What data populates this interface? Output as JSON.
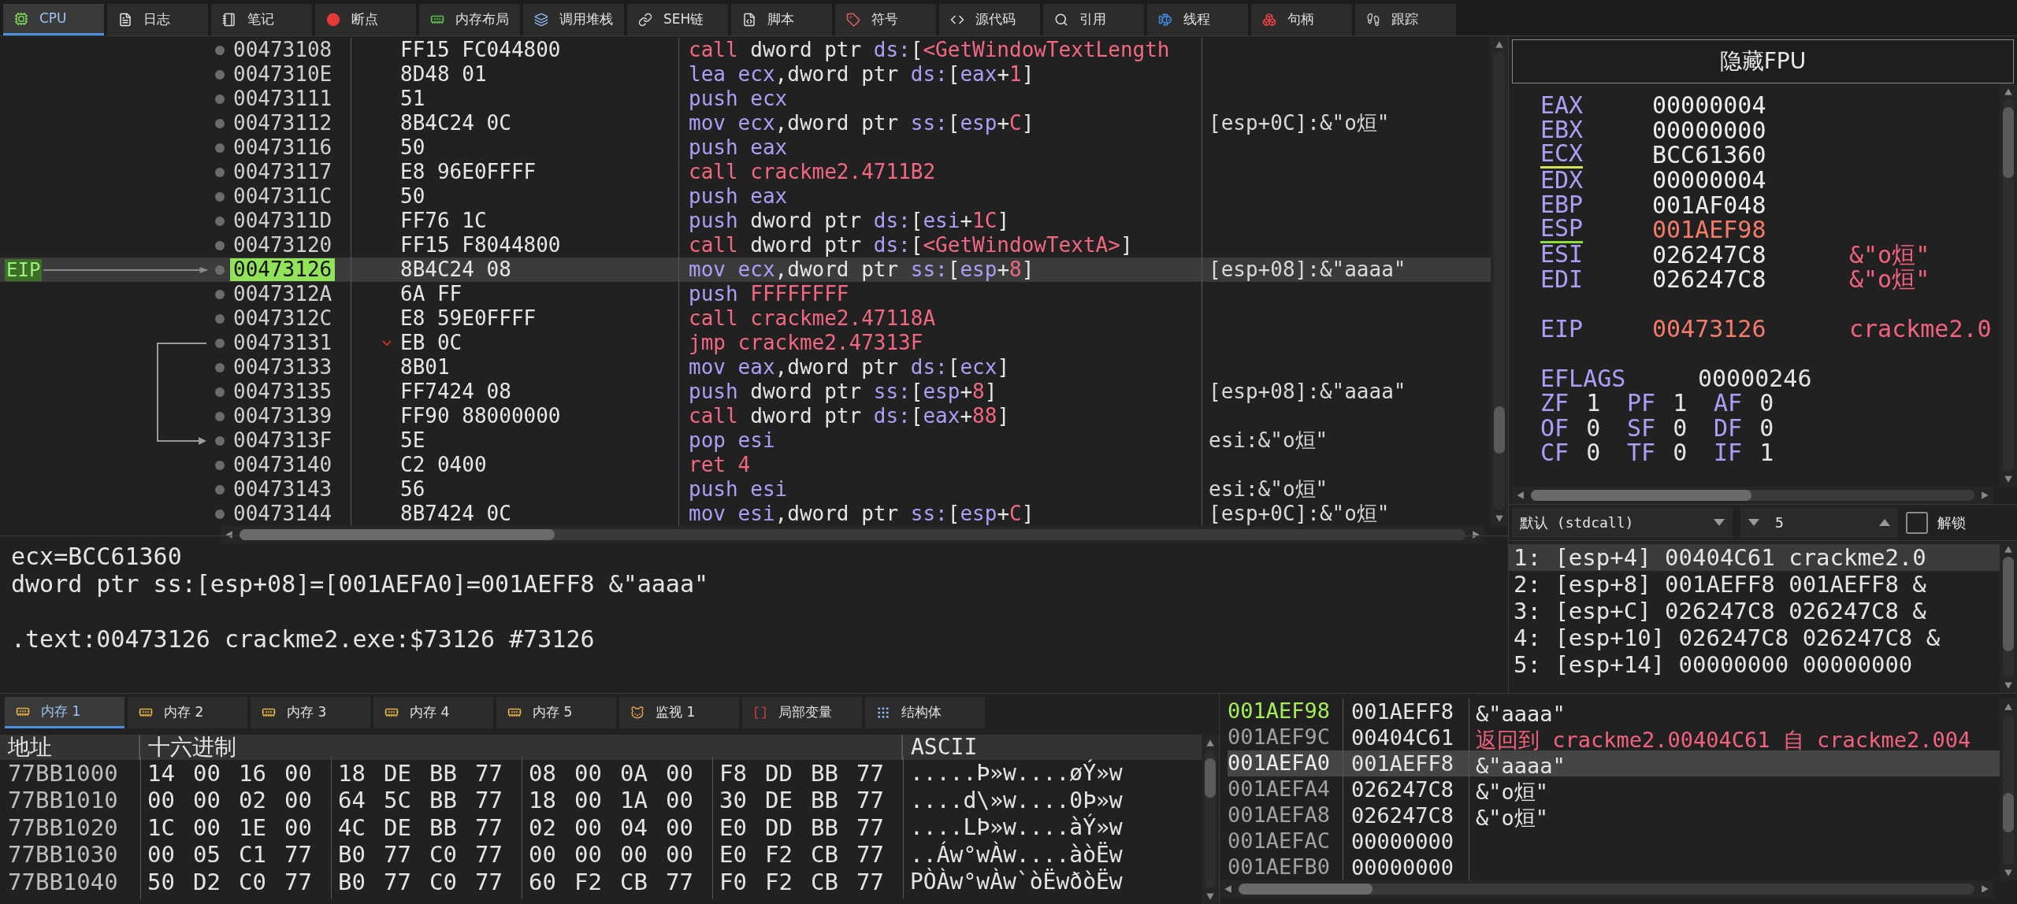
{
  "tabs": [
    {
      "label": "CPU",
      "selected": true
    },
    {
      "label": "日志",
      "selected": false
    },
    {
      "label": "笔记",
      "selected": false
    },
    {
      "label": "断点",
      "selected": false
    },
    {
      "label": "内存布局",
      "selected": false
    },
    {
      "label": "调用堆栈",
      "selected": false
    },
    {
      "label": "SEH链",
      "selected": false
    },
    {
      "label": "脚本",
      "selected": false
    },
    {
      "label": "符号",
      "selected": false
    },
    {
      "label": "源代码",
      "selected": false
    },
    {
      "label": "引用",
      "selected": false
    },
    {
      "label": "线程",
      "selected": false
    },
    {
      "label": "句柄",
      "selected": false
    },
    {
      "label": "跟踪",
      "selected": false
    }
  ],
  "disassembly": {
    "eip_label": "EIP",
    "rows": [
      {
        "address": "00473108",
        "bytes": "FF15 FC044800",
        "instruction": [
          {
            "text": "call",
            "kind": "branch"
          },
          {
            "text": " dword ptr ",
            "kind": "plain"
          },
          {
            "text": "ds:",
            "kind": "keyword"
          },
          {
            "text": "[",
            "kind": "plain"
          },
          {
            "text": "<GetWindowTextLength",
            "kind": "branch"
          }
        ],
        "selected": false,
        "branch": false,
        "jump_source": false,
        "jump_target": false
      },
      {
        "address": "0047310E",
        "bytes": "8D48 01",
        "instruction": [
          {
            "text": "lea",
            "kind": "keyword"
          },
          {
            "text": " ecx",
            "kind": "keyword"
          },
          {
            "text": ",dword ptr ",
            "kind": "plain"
          },
          {
            "text": "ds:",
            "kind": "keyword"
          },
          {
            "text": "[",
            "kind": "plain"
          },
          {
            "text": "eax",
            "kind": "keyword"
          },
          {
            "text": "+",
            "kind": "plain"
          },
          {
            "text": "1",
            "kind": "number"
          },
          {
            "text": "]",
            "kind": "plain"
          }
        ],
        "selected": false,
        "branch": false,
        "jump_source": false,
        "jump_target": false
      },
      {
        "address": "00473111",
        "bytes": "51",
        "instruction": [
          {
            "text": "push",
            "kind": "keyword"
          },
          {
            "text": " ecx",
            "kind": "keyword"
          }
        ],
        "selected": false,
        "branch": false,
        "jump_source": false,
        "jump_target": false
      },
      {
        "address": "00473112",
        "bytes": "8B4C24 0C",
        "instruction": [
          {
            "text": "mov",
            "kind": "keyword"
          },
          {
            "text": " ecx",
            "kind": "keyword"
          },
          {
            "text": ",dword ptr ",
            "kind": "plain"
          },
          {
            "text": "ss:",
            "kind": "keyword"
          },
          {
            "text": "[",
            "kind": "plain"
          },
          {
            "text": "esp",
            "kind": "keyword"
          },
          {
            "text": "+",
            "kind": "plain"
          },
          {
            "text": "C",
            "kind": "number"
          },
          {
            "text": "]",
            "kind": "plain"
          }
        ],
        "comment": "[esp+0C]:&\"o烜\"",
        "selected": false,
        "branch": false,
        "jump_source": false,
        "jump_target": false
      },
      {
        "address": "00473116",
        "bytes": "50",
        "instruction": [
          {
            "text": "push",
            "kind": "keyword"
          },
          {
            "text": " eax",
            "kind": "keyword"
          }
        ],
        "selected": false,
        "branch": false,
        "jump_source": false,
        "jump_target": false
      },
      {
        "address": "00473117",
        "bytes": "E8 96E0FFFF",
        "instruction": [
          {
            "text": "call",
            "kind": "branch"
          },
          {
            "text": " crackme2.4711B2",
            "kind": "branch"
          }
        ],
        "selected": false,
        "branch": false,
        "jump_source": false,
        "jump_target": false
      },
      {
        "address": "0047311C",
        "bytes": "50",
        "instruction": [
          {
            "text": "push",
            "kind": "keyword"
          },
          {
            "text": " eax",
            "kind": "keyword"
          }
        ],
        "selected": false,
        "branch": false,
        "jump_source": false,
        "jump_target": false
      },
      {
        "address": "0047311D",
        "bytes": "FF76 1C",
        "instruction": [
          {
            "text": "push",
            "kind": "keyword"
          },
          {
            "text": " dword ptr ",
            "kind": "plain"
          },
          {
            "text": "ds:",
            "kind": "keyword"
          },
          {
            "text": "[",
            "kind": "plain"
          },
          {
            "text": "esi",
            "kind": "keyword"
          },
          {
            "text": "+",
            "kind": "plain"
          },
          {
            "text": "1C",
            "kind": "number"
          },
          {
            "text": "]",
            "kind": "plain"
          }
        ],
        "selected": false,
        "branch": false,
        "jump_source": false,
        "jump_target": false
      },
      {
        "address": "00473120",
        "bytes": "FF15 F8044800",
        "instruction": [
          {
            "text": "call",
            "kind": "branch"
          },
          {
            "text": " dword ptr ",
            "kind": "plain"
          },
          {
            "text": "ds:",
            "kind": "keyword"
          },
          {
            "text": "[",
            "kind": "plain"
          },
          {
            "text": "<GetWindowTextA>",
            "kind": "branch"
          },
          {
            "text": "]",
            "kind": "plain"
          }
        ],
        "selected": false,
        "branch": false,
        "jump_source": false,
        "jump_target": false
      },
      {
        "address": "00473126",
        "bytes": "8B4C24 08",
        "instruction": [
          {
            "text": "mov",
            "kind": "keyword"
          },
          {
            "text": " ecx",
            "kind": "keyword"
          },
          {
            "text": ",dword ptr ",
            "kind": "plain"
          },
          {
            "text": "ss:",
            "kind": "keyword"
          },
          {
            "text": "[",
            "kind": "plain"
          },
          {
            "text": "esp",
            "kind": "keyword"
          },
          {
            "text": "+",
            "kind": "plain"
          },
          {
            "text": "8",
            "kind": "number"
          },
          {
            "text": "]",
            "kind": "plain"
          }
        ],
        "comment": "[esp+08]:&\"aaaa\"",
        "selected": true,
        "branch": false,
        "jump_source": false,
        "jump_target": false
      },
      {
        "address": "0047312A",
        "bytes": "6A FF",
        "instruction": [
          {
            "text": "push",
            "kind": "keyword"
          },
          {
            "text": " FFFFFFFF",
            "kind": "number"
          }
        ],
        "selected": false,
        "branch": false,
        "jump_source": false,
        "jump_target": false
      },
      {
        "address": "0047312C",
        "bytes": "E8 59E0FFFF",
        "instruction": [
          {
            "text": "call",
            "kind": "branch"
          },
          {
            "text": " crackme2.47118A",
            "kind": "branch"
          }
        ],
        "selected": false,
        "branch": false,
        "jump_source": false,
        "jump_target": false
      },
      {
        "address": "00473131",
        "bytes": "EB 0C",
        "instruction": [
          {
            "text": "jmp",
            "kind": "branch"
          },
          {
            "text": " crackme2.47313F",
            "kind": "branch"
          }
        ],
        "selected": false,
        "branch": true,
        "jump_source": true,
        "jump_target": false
      },
      {
        "address": "00473133",
        "bytes": "8B01",
        "instruction": [
          {
            "text": "mov",
            "kind": "keyword"
          },
          {
            "text": " eax",
            "kind": "keyword"
          },
          {
            "text": ",dword ptr ",
            "kind": "plain"
          },
          {
            "text": "ds:",
            "kind": "keyword"
          },
          {
            "text": "[",
            "kind": "plain"
          },
          {
            "text": "ecx",
            "kind": "keyword"
          },
          {
            "text": "]",
            "kind": "plain"
          }
        ],
        "selected": false,
        "branch": false,
        "jump_source": false,
        "jump_target": false
      },
      {
        "address": "00473135",
        "bytes": "FF7424 08",
        "instruction": [
          {
            "text": "push",
            "kind": "keyword"
          },
          {
            "text": " dword ptr ",
            "kind": "plain"
          },
          {
            "text": "ss:",
            "kind": "keyword"
          },
          {
            "text": "[",
            "kind": "plain"
          },
          {
            "text": "esp",
            "kind": "keyword"
          },
          {
            "text": "+",
            "kind": "plain"
          },
          {
            "text": "8",
            "kind": "number"
          },
          {
            "text": "]",
            "kind": "plain"
          }
        ],
        "comment": "[esp+08]:&\"aaaa\"",
        "selected": false,
        "branch": false,
        "jump_source": false,
        "jump_target": false
      },
      {
        "address": "00473139",
        "bytes": "FF90 88000000",
        "instruction": [
          {
            "text": "call",
            "kind": "branch"
          },
          {
            "text": " dword ptr ",
            "kind": "plain"
          },
          {
            "text": "ds:",
            "kind": "keyword"
          },
          {
            "text": "[",
            "kind": "plain"
          },
          {
            "text": "eax",
            "kind": "keyword"
          },
          {
            "text": "+",
            "kind": "plain"
          },
          {
            "text": "88",
            "kind": "number"
          },
          {
            "text": "]",
            "kind": "plain"
          }
        ],
        "selected": false,
        "branch": false,
        "jump_source": false,
        "jump_target": false
      },
      {
        "address": "0047313F",
        "bytes": "5E",
        "instruction": [
          {
            "text": "pop",
            "kind": "keyword"
          },
          {
            "text": " esi",
            "kind": "keyword"
          }
        ],
        "comment": "esi:&\"o烜\"",
        "selected": false,
        "branch": false,
        "jump_source": false,
        "jump_target": true
      },
      {
        "address": "00473140",
        "bytes": "C2 0400",
        "instruction": [
          {
            "text": "ret",
            "kind": "branch"
          },
          {
            "text": " 4",
            "kind": "number"
          }
        ],
        "selected": false,
        "branch": false,
        "jump_source": false,
        "jump_target": false
      },
      {
        "address": "00473143",
        "bytes": "56",
        "instruction": [
          {
            "text": "push",
            "kind": "keyword"
          },
          {
            "text": " esi",
            "kind": "keyword"
          }
        ],
        "comment": "esi:&\"o烜\"",
        "selected": false,
        "branch": false,
        "jump_source": false,
        "jump_target": false
      },
      {
        "address": "00473144",
        "bytes": "8B7424 0C",
        "instruction": [
          {
            "text": "mov",
            "kind": "keyword"
          },
          {
            "text": " esi",
            "kind": "keyword"
          },
          {
            "text": ",dword ptr ",
            "kind": "plain"
          },
          {
            "text": "ss:",
            "kind": "keyword"
          },
          {
            "text": "[",
            "kind": "plain"
          },
          {
            "text": "esp",
            "kind": "keyword"
          },
          {
            "text": "+",
            "kind": "plain"
          },
          {
            "text": "C",
            "kind": "number"
          },
          {
            "text": "]",
            "kind": "plain"
          }
        ],
        "comment": "[esp+0C]:&\"o烜\"",
        "selected": false,
        "branch": false,
        "jump_source": false,
        "jump_target": false
      }
    ]
  },
  "info": [
    "ecx=BCC61360",
    "dword ptr ss:[esp+08]=[001AEFA0]=001AEFF8 &\"aaaa\"",
    ".text:00473126 crackme2.exe:$73126 #73126"
  ],
  "registers": {
    "fpu_button": "隐藏FPU",
    "general": [
      {
        "name": "EAX",
        "value": "00000004",
        "changed": false
      },
      {
        "name": "EBX",
        "value": "00000000",
        "changed": false
      },
      {
        "name": "ECX",
        "value": "BCC61360",
        "changed": false,
        "color": "#d4e157"
      },
      {
        "name": "EDX",
        "value": "00000004",
        "changed": false
      },
      {
        "name": "EBP",
        "value": "001AF048",
        "changed": false
      },
      {
        "name": "ESP",
        "value": "001AEF98",
        "changed": true,
        "color": "#8bdc3c"
      },
      {
        "name": "ESI",
        "value": "026247C8",
        "changed": false,
        "comment": "&\"o烜\""
      },
      {
        "name": "EDI",
        "value": "026247C8",
        "changed": false,
        "comment": "&\"o烜\""
      }
    ],
    "eip": {
      "name": "EIP",
      "value": "00473126",
      "changed": true,
      "comment": "crackme2.0"
    },
    "eflags": {
      "name": "EFLAGS",
      "value": "00000246"
    },
    "flags": [
      {
        "name": "ZF",
        "value": "1"
      },
      {
        "name": "PF",
        "value": "1"
      },
      {
        "name": "AF",
        "value": "0"
      },
      {
        "name": "OF",
        "value": "0"
      },
      {
        "name": "SF",
        "value": "0"
      },
      {
        "name": "DF",
        "value": "0"
      },
      {
        "name": "CF",
        "value": "0"
      },
      {
        "name": "TF",
        "value": "0"
      },
      {
        "name": "IF",
        "value": "1"
      }
    ]
  },
  "arguments": {
    "convention": "默认 (stdcall)",
    "count": "5",
    "unlock": {
      "label": "解锁",
      "checked": false
    },
    "rows": [
      {
        "text": "1: [esp+4] 00404C61 crackme2.0",
        "selected": true
      },
      {
        "text": "2: [esp+8] 001AEFF8 001AEFF8 &",
        "selected": false
      },
      {
        "text": "3: [esp+C] 026247C8 026247C8 &",
        "selected": false
      },
      {
        "text": "4: [esp+10] 026247C8 026247C8 &",
        "selected": false
      },
      {
        "text": "5: [esp+14] 00000000 00000000",
        "selected": false
      }
    ]
  },
  "memory": {
    "tabs": [
      {
        "label": "内存 1",
        "selected": true
      },
      {
        "label": "内存 2",
        "selected": false
      },
      {
        "label": "内存 3",
        "selected": false
      },
      {
        "label": "内存 4",
        "selected": false
      },
      {
        "label": "内存 5",
        "selected": false
      },
      {
        "label": "监视 1",
        "selected": false
      },
      {
        "label": "局部变量",
        "selected": false
      },
      {
        "label": "结构体",
        "selected": false
      }
    ],
    "columns": [
      "地址",
      "十六进制",
      "ASCII"
    ],
    "rows": [
      {
        "address": "77BB1000",
        "bytes": [
          "14",
          "00",
          "16",
          "00",
          "18",
          "DE",
          "BB",
          "77",
          "08",
          "00",
          "0A",
          "00",
          "F8",
          "DD",
          "BB",
          "77"
        ],
        "ascii": ".....Þ»w....øÝ»w"
      },
      {
        "address": "77BB1010",
        "bytes": [
          "00",
          "00",
          "02",
          "00",
          "64",
          "5C",
          "BB",
          "77",
          "18",
          "00",
          "1A",
          "00",
          "30",
          "DE",
          "BB",
          "77"
        ],
        "ascii": "....d\\»w....0Þ»w"
      },
      {
        "address": "77BB1020",
        "bytes": [
          "1C",
          "00",
          "1E",
          "00",
          "4C",
          "DE",
          "BB",
          "77",
          "02",
          "00",
          "04",
          "00",
          "E0",
          "DD",
          "BB",
          "77"
        ],
        "ascii": "....LÞ»w....àÝ»w"
      },
      {
        "address": "77BB1030",
        "bytes": [
          "00",
          "05",
          "C1",
          "77",
          "B0",
          "77",
          "C0",
          "77",
          "00",
          "00",
          "00",
          "00",
          "E0",
          "F2",
          "CB",
          "77"
        ],
        "ascii": "..Áw°wÀw....àòËw"
      },
      {
        "address": "77BB1040",
        "bytes": [
          "50",
          "D2",
          "C0",
          "77",
          "B0",
          "77",
          "C0",
          "77",
          "60",
          "F2",
          "CB",
          "77",
          "F0",
          "F2",
          "CB",
          "77"
        ],
        "ascii": "PÒÀw°wÀw`òËwðòËw"
      }
    ]
  },
  "stack": {
    "rows": [
      {
        "address": "001AEF98",
        "value": "001AEFF8",
        "comment": "&\"aaaa\"",
        "kind": "plain",
        "current": true,
        "selected": false
      },
      {
        "address": "001AEF9C",
        "value": "00404C61",
        "comment": "返回到 crackme2.00404C61 自 crackme2.004",
        "kind": "return",
        "current": false,
        "selected": false
      },
      {
        "address": "001AEFA0",
        "value": "001AEFF8",
        "comment": "&\"aaaa\"",
        "kind": "plain",
        "current": false,
        "selected": true
      },
      {
        "address": "001AEFA4",
        "value": "026247C8",
        "comment": "&\"o烜\"",
        "kind": "plain",
        "current": false,
        "selected": false
      },
      {
        "address": "001AEFA8",
        "value": "026247C8",
        "comment": "&\"o烜\"",
        "kind": "plain",
        "current": false,
        "selected": false
      },
      {
        "address": "001AEFAC",
        "value": "00000000",
        "current": false,
        "selected": false
      },
      {
        "address": "001AEFB0",
        "value": "00000000",
        "current": false,
        "selected": false
      }
    ]
  }
}
